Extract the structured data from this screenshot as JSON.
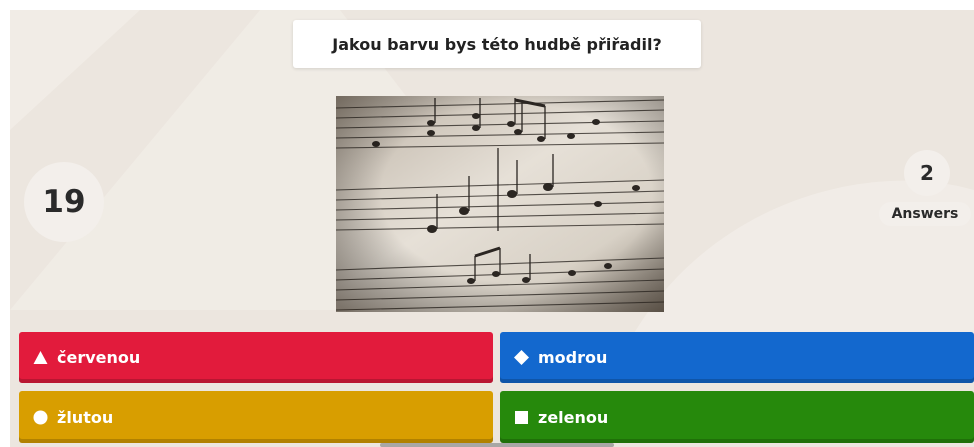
{
  "question": {
    "text": "Jakou barvu bys této hudbě přiřadil?"
  },
  "timer": {
    "seconds": "19"
  },
  "answers_counter": {
    "count": "2",
    "label": "Answers"
  },
  "media": {
    "icon": "sheet-music-photo"
  },
  "answer_options": [
    {
      "label": "červenou",
      "shape": "triangle",
      "color": "#e21b3c"
    },
    {
      "label": "modrou",
      "shape": "diamond",
      "color": "#1368ce"
    },
    {
      "label": "žlutou",
      "shape": "circle",
      "color": "#d89e00"
    },
    {
      "label": "zelenou",
      "shape": "square",
      "color": "#26890c"
    }
  ],
  "colors": {
    "background": "#ece6df",
    "accent_white": "#ffffff"
  }
}
